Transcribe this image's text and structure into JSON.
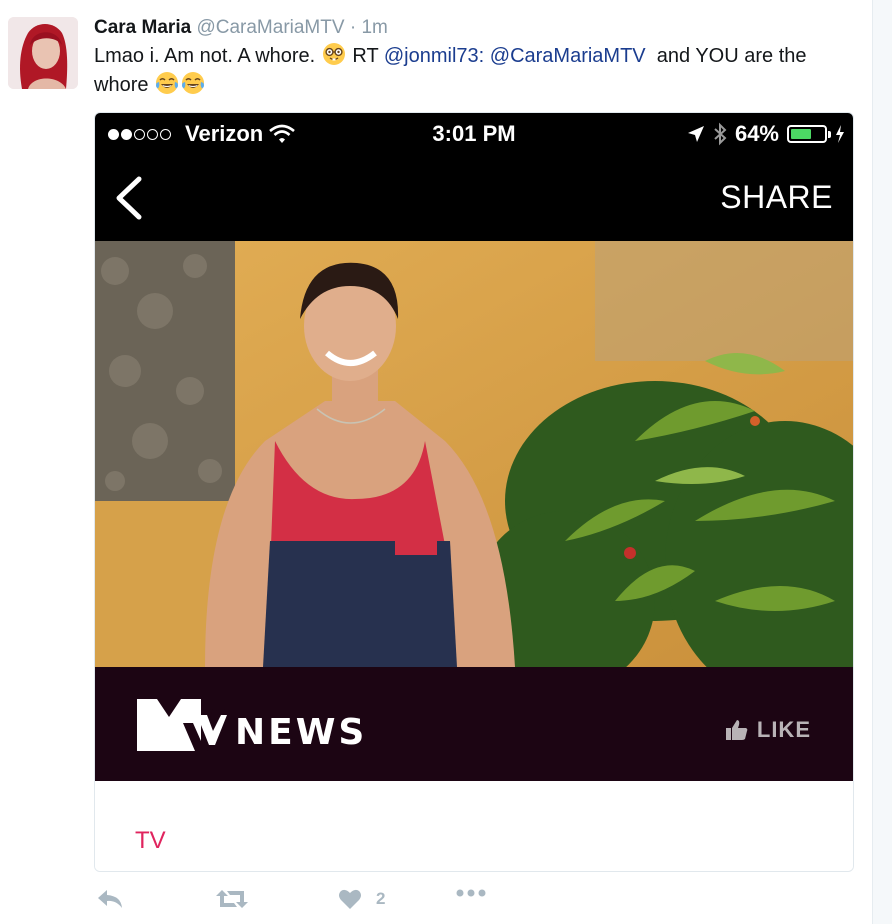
{
  "tweet": {
    "name": "Cara Maria",
    "handle": "@CaraMariaMTV",
    "separator": "·",
    "time": "1m",
    "text_part1": "Lmao i. Am not. A whore.",
    "text_part2": "RT",
    "mention1": "@jonmil73:",
    "mention2": "@CaraMariaMTV",
    "text_part3": "and YOU are the whore",
    "emojis": [
      "nerd-face",
      "face-with-tears-of-joy",
      "face-with-tears-of-joy"
    ]
  },
  "screenshot": {
    "carrier": "Verizon",
    "signal_bars_on": 2,
    "signal_bars_total": 5,
    "clock": "3:01 PM",
    "battery": "64%",
    "battery_level": 0.64,
    "share_label": "SHARE",
    "news_label": "NEWS",
    "like_label": "LIKE"
  },
  "card": {
    "link_label": "TV"
  },
  "actions": {
    "like_count": "2"
  },
  "colors": {
    "mention": "#1b3d8f",
    "link": "#e0245e",
    "footer_bg": "#1c0513",
    "action_icon": "#aab8c2"
  }
}
